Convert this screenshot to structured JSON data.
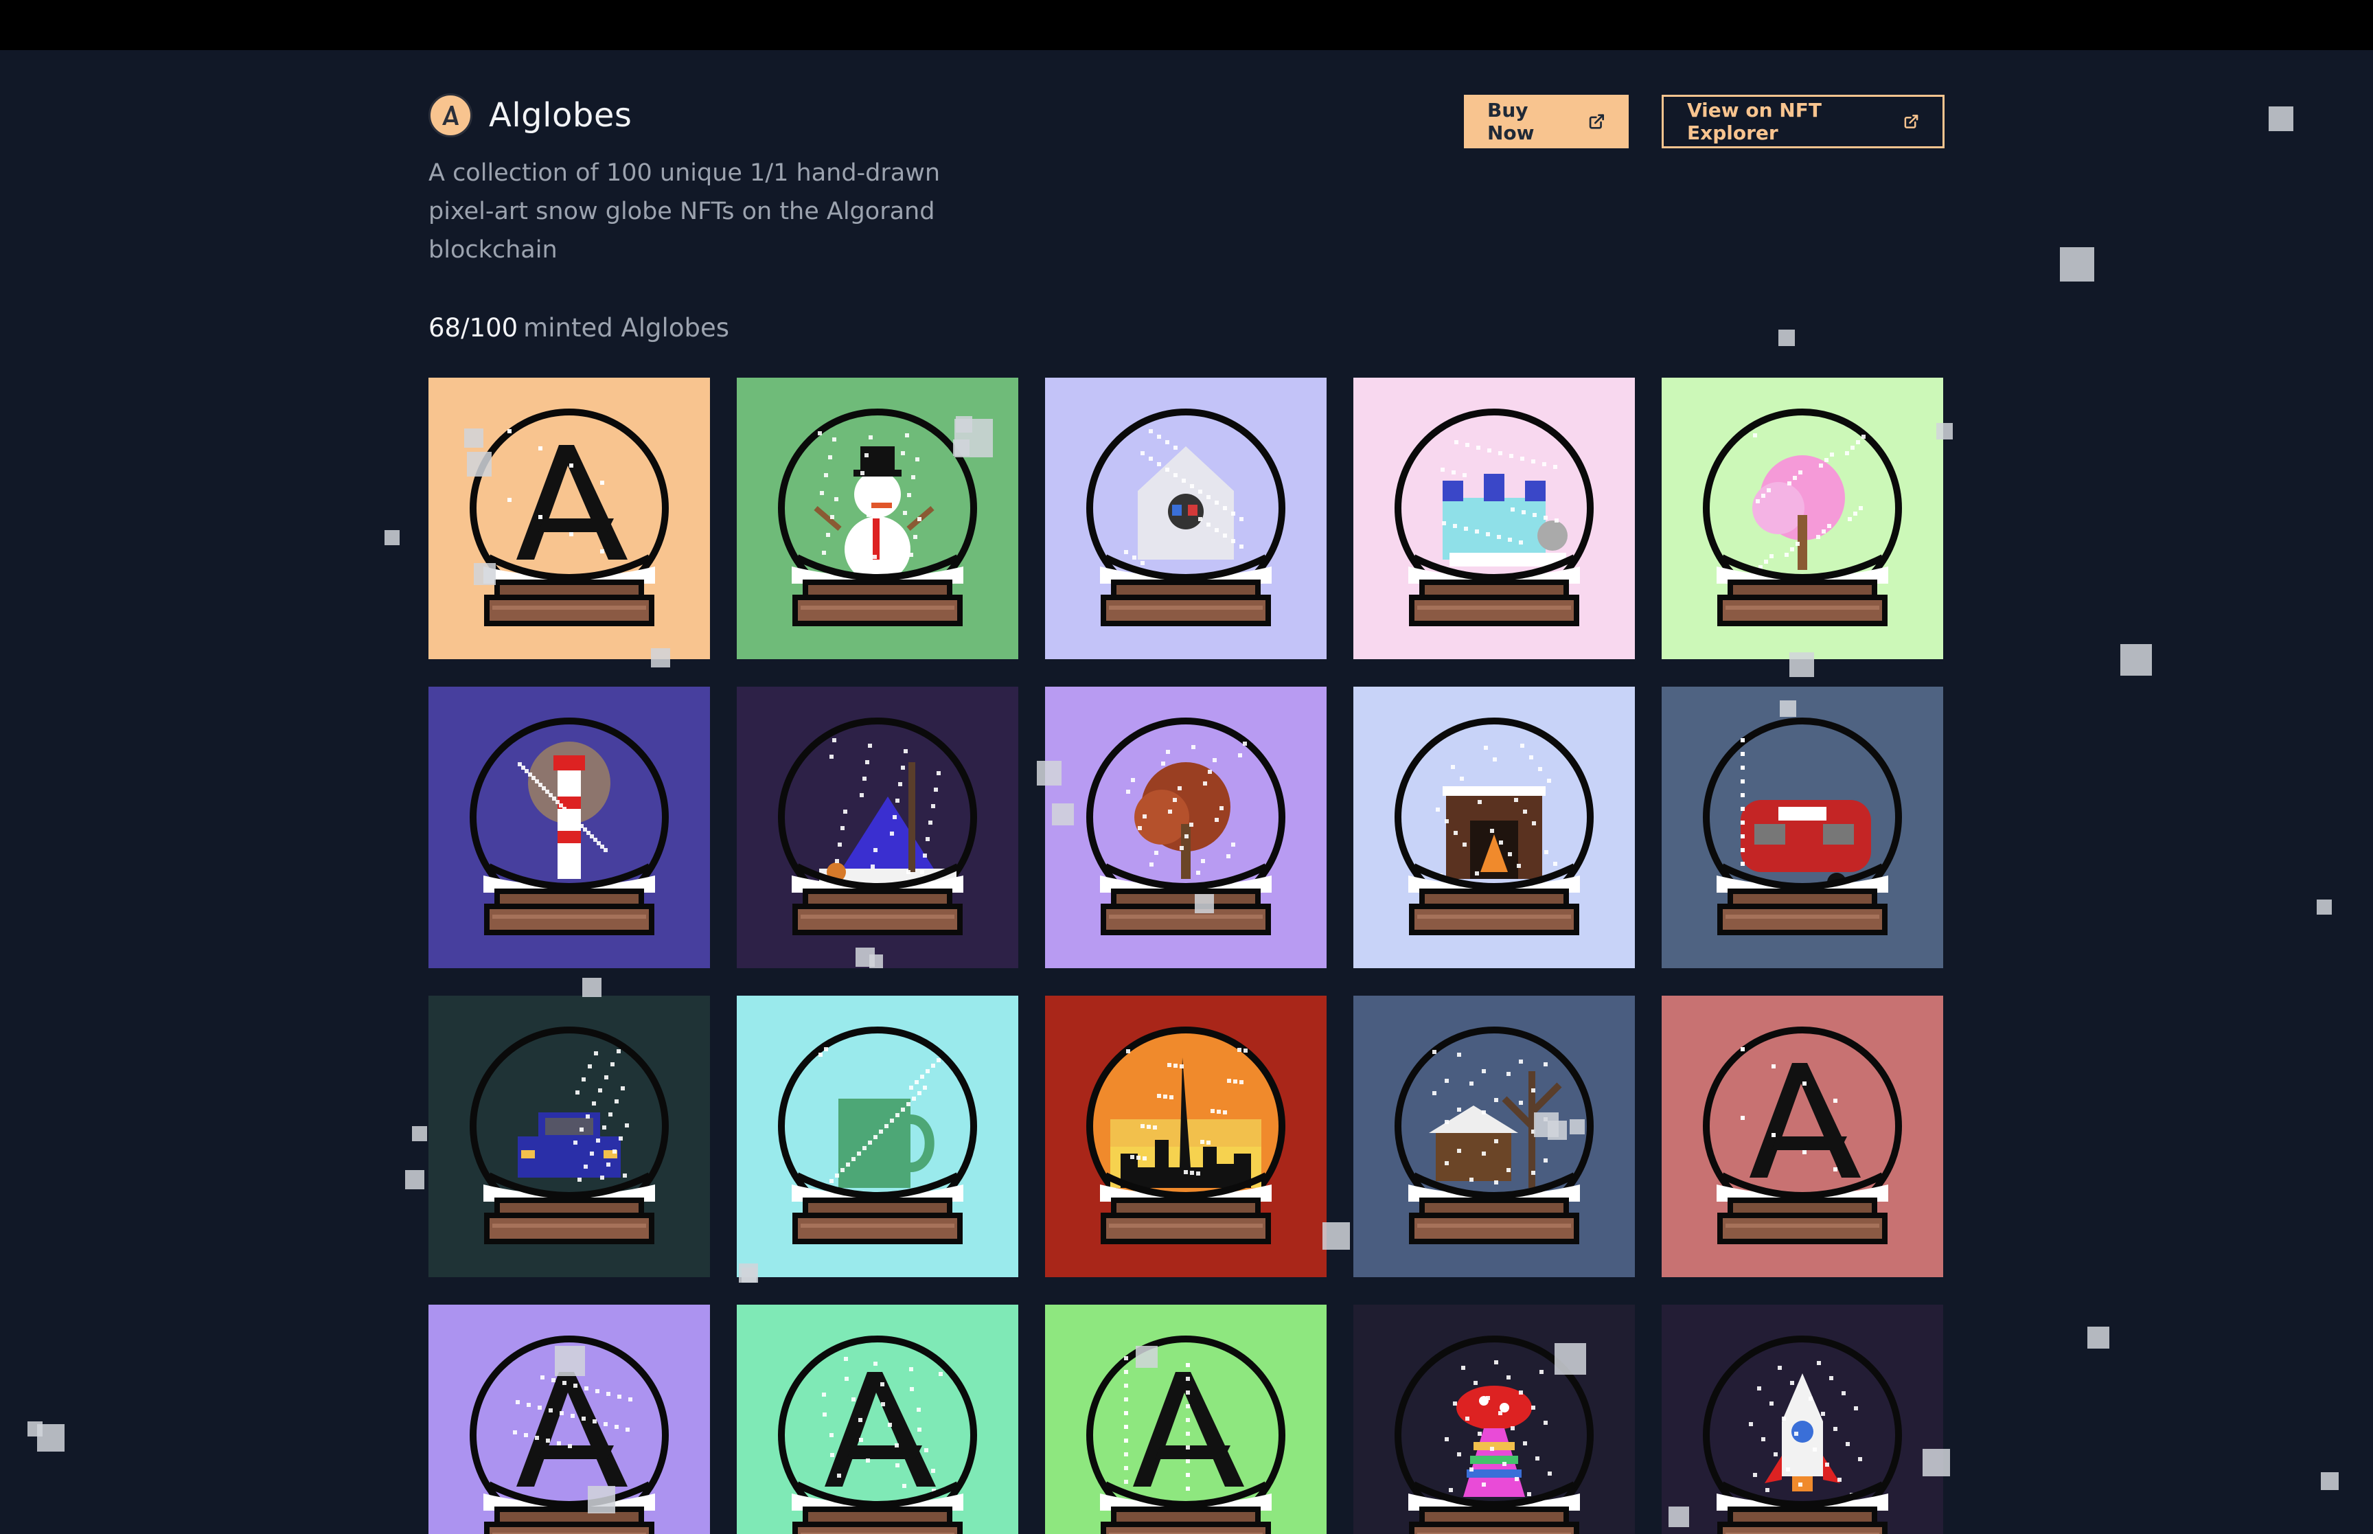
{
  "header": {
    "title": "Alglobes",
    "logo_icon": "algorand-logo-icon",
    "description": "A collection of 100 unique 1/1 hand-drawn pixel-art snow globe NFTs on the Algorand blockchain",
    "buy_label": "Buy Now",
    "explorer_label": "View on NFT Explorer"
  },
  "minted": {
    "count": "68/100",
    "label": "minted Alglobes"
  },
  "colors": {
    "background": "#111827",
    "accent": "#f8c48f",
    "muted_text": "#9ca3af"
  },
  "globes": [
    {
      "bg": "#f8c48f",
      "inner": "#f8c48f",
      "subject": "algorand-logo"
    },
    {
      "bg": "#6fbb79",
      "inner": "#6fbb79",
      "subject": "snowman"
    },
    {
      "bg": "#c3c3f8",
      "inner": "#c3c3f8",
      "subject": "birdhouse"
    },
    {
      "bg": "#f8d8ef",
      "inner": "#f8d8ef",
      "subject": "castle"
    },
    {
      "bg": "#ccf8b8",
      "inner": "#ccf8b8",
      "subject": "cherry-tree"
    },
    {
      "bg": "#473f9e",
      "inner": "#473f9e",
      "subject": "lighthouse"
    },
    {
      "bg": "#2d2147",
      "inner": "#2d2147",
      "subject": "tent"
    },
    {
      "bg": "#b89bf2",
      "inner": "#b89bf2",
      "subject": "autumn-tree"
    },
    {
      "bg": "#c8d3f8",
      "inner": "#c8d3f8",
      "subject": "fireplace"
    },
    {
      "bg": "#4f6382",
      "inner": "#4f6382",
      "subject": "camper"
    },
    {
      "bg": "#1f3336",
      "inner": "#1f3336",
      "subject": "car"
    },
    {
      "bg": "#9aeaec",
      "inner": "#9aeaec",
      "subject": "mug"
    },
    {
      "bg": "#a92619",
      "inner": "#f08a2c",
      "subject": "city-skyline"
    },
    {
      "bg": "#4a5d80",
      "inner": "#4a5d80",
      "subject": "cabin"
    },
    {
      "bg": "#c87272",
      "inner": "#c87272",
      "subject": "algorand-logo"
    },
    {
      "bg": "#ac93f0",
      "inner": "#ac93f0",
      "subject": "algorand-logo"
    },
    {
      "bg": "#7fe9b6",
      "inner": "#7fe9b6",
      "subject": "algorand-logo"
    },
    {
      "bg": "#8ee77f",
      "inner": "#8ee77f",
      "subject": "algorand-logo"
    },
    {
      "bg": "#1f1d30",
      "inner": "#1f1d30",
      "subject": "mushroom-ufo"
    },
    {
      "bg": "#231d35",
      "inner": "#231d35",
      "subject": "rocket"
    }
  ]
}
